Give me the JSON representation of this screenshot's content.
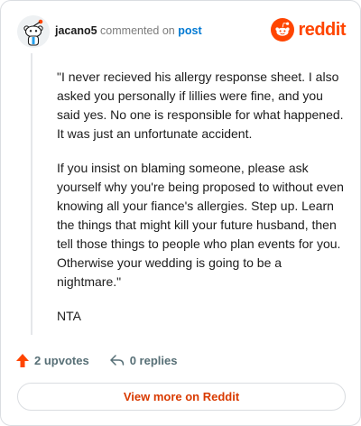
{
  "header": {
    "username": "jacano5",
    "action_text": "commented on",
    "post_link": "post",
    "brand": "reddit"
  },
  "comment": {
    "paragraphs": [
      "\"I never recieved his allergy response sheet. I also asked you personally if lillies were fine, and you said yes. No one is responsible for what happened. It was just an unfortunate accident.",
      "If you insist on blaming someone, please ask yourself why you're being proposed to without even knowing all your fiance's allergies. Step up. Learn the things that might kill your future husband, then tell those things to people who plan events for you. Otherwise your wedding is going to be a nightmare.\"",
      "NTA"
    ]
  },
  "actions": {
    "upvotes": "2 upvotes",
    "replies": "0 replies"
  },
  "footer": {
    "view_more": "View more on Reddit"
  },
  "colors": {
    "brand": "#ff4500",
    "upvote_arrow": "#ff4500",
    "link": "#0079d3",
    "view_more_text": "#d93a00"
  },
  "icons": {
    "avatar": "snoo-avatar-icon",
    "logo": "reddit-logo-icon",
    "upvote": "upvote-arrow-icon",
    "reply": "reply-icon"
  }
}
